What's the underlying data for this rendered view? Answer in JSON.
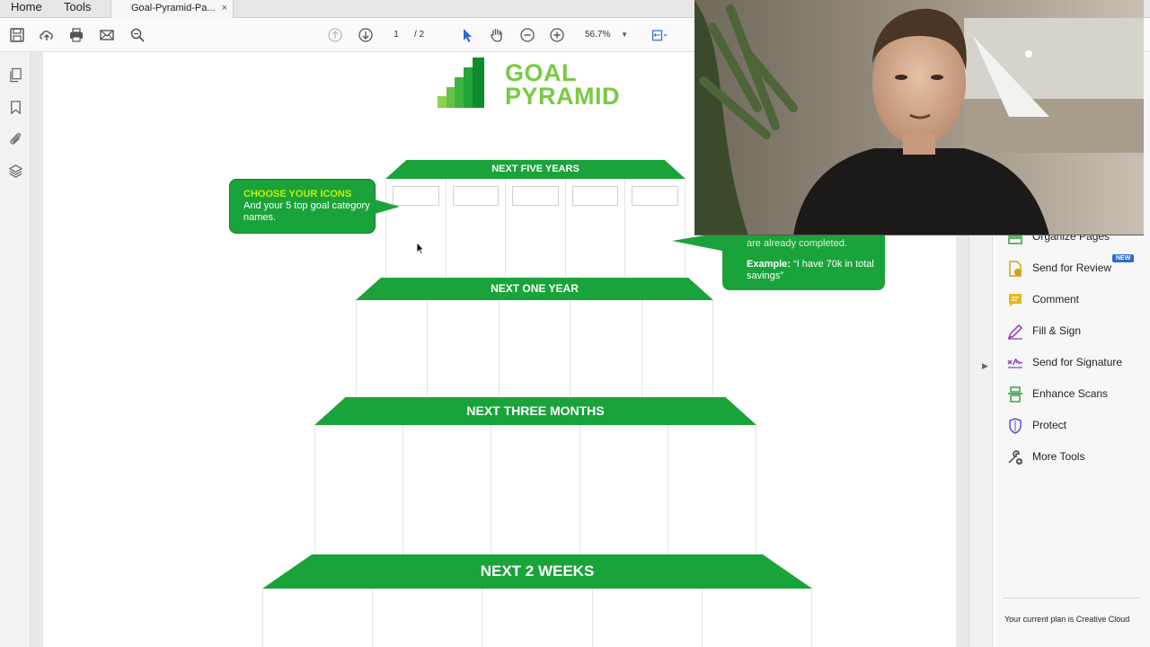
{
  "menu": {
    "home": "Home",
    "tools": "Tools"
  },
  "tab": {
    "title": "Goal-Pyramid-Pa...",
    "close": "×"
  },
  "toolbar": {
    "page_current": "1",
    "page_total": "/ 2",
    "zoom": "56.7%"
  },
  "document": {
    "logo_line1": "GOAL",
    "logo_line2": "PYRAMID",
    "tiers": [
      {
        "label": "NEXT FIVE YEARS"
      },
      {
        "label": "NEXT ONE YEAR"
      },
      {
        "label": "NEXT THREE MONTHS"
      },
      {
        "label": "NEXT 2 WEEKS"
      }
    ],
    "callout_left": {
      "heading": "CHOOSE YOUR ICONS",
      "body": "And your 5 top goal category names."
    },
    "callout_right": {
      "top": "are already completed.",
      "example_label": "Example:",
      "example_text": "“I have 70k in total savings”"
    }
  },
  "right_panel": {
    "tools": [
      {
        "label": "Organize Pages",
        "icon": "organize-pages-icon"
      },
      {
        "label": "Send for Review",
        "icon": "send-review-icon"
      },
      {
        "label": "Comment",
        "icon": "comment-icon"
      },
      {
        "label": "Fill & Sign",
        "icon": "fill-sign-icon"
      },
      {
        "label": "Send for Signature",
        "icon": "send-signature-icon"
      },
      {
        "label": "Enhance Scans",
        "icon": "enhance-scans-icon"
      },
      {
        "label": "Protect",
        "icon": "protect-icon"
      },
      {
        "label": "More Tools",
        "icon": "more-tools-icon"
      }
    ],
    "new_badge": "NEW",
    "plan_text": "Your current plan is Creative Cloud"
  },
  "colors": {
    "brand_green": "#1aa33a",
    "logo_green": "#7ac943",
    "highlight": "#c7f000",
    "accent_blue": "#2c6bd6"
  }
}
